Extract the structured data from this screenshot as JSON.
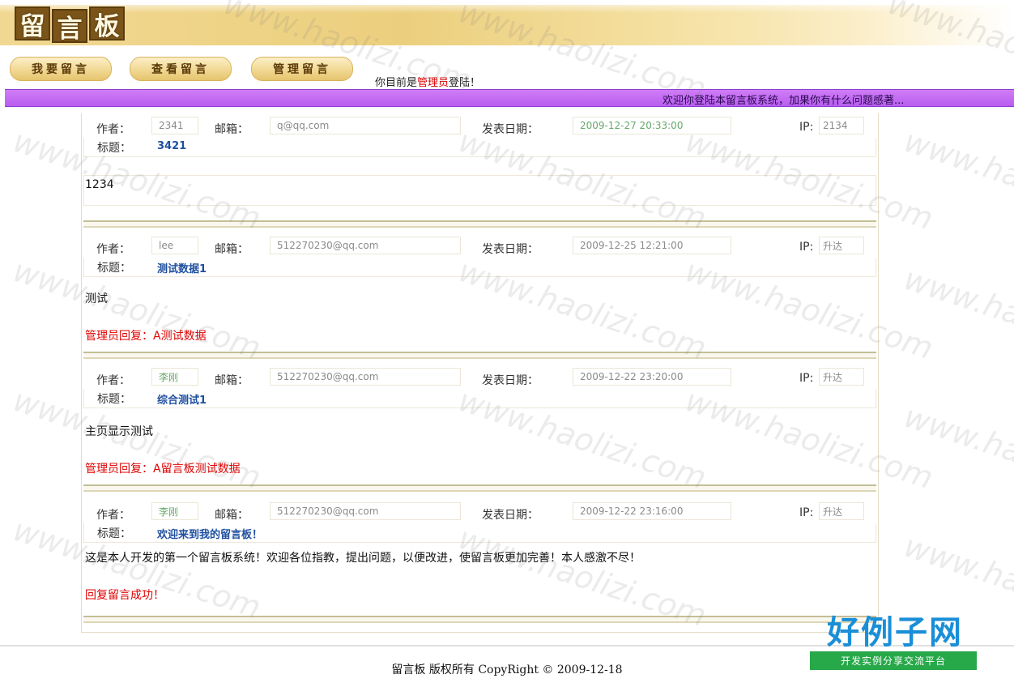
{
  "header": {
    "logo_chars": [
      "留",
      "言",
      "板"
    ]
  },
  "nav": [
    {
      "label": "我要留言"
    },
    {
      "label": "查看留言"
    },
    {
      "label": "管理留言"
    }
  ],
  "login": {
    "prefix": "你目前是",
    "role": "管理员",
    "suffix": "登陆！"
  },
  "marquee": {
    "text": "欢迎你登陆本留言板系统，加果你有什么问题感著..."
  },
  "labels": {
    "author": "作者：",
    "email": "邮箱：",
    "date": "发表日期：",
    "ip": "IP:",
    "title": "标题："
  },
  "messages": [
    {
      "author": "2341",
      "email": "q@qq.com",
      "date": "2009-12-27 20:33:00",
      "ip": "2134",
      "title": "3421",
      "content": "1234",
      "reply": ""
    },
    {
      "author": "lee",
      "email": "512270230@qq.com",
      "date": "2009-12-25 12:21:00",
      "ip": "升达",
      "title": "测试数据1",
      "content": "测试",
      "reply": "管理员回复：A测试数据"
    },
    {
      "author": "李刚",
      "email": "512270230@qq.com",
      "date": "2009-12-22 23:20:00",
      "ip": "升达",
      "title": "综合测试1",
      "content": "主页显示测试",
      "reply": "管理员回复：A留言板测试数据"
    },
    {
      "author": "李刚",
      "email": "512270230@qq.com",
      "date": "2009-12-22 23:16:00",
      "ip": "升达",
      "title": "欢迎来到我的留言板！",
      "content": "这是本人开发的第一个留言板系统！欢迎各位指教，提出问题，以便改进，使留言板更加完善！本人感激不尽！",
      "reply": "回复留言成功！"
    }
  ],
  "footer": {
    "copyright": "留言板  版权所有  CopyRight © 2009-12-18"
  },
  "watermark": {
    "text": "www.haolizi.com",
    "brand": "好例子网",
    "brand_sub": "开发实例分享交流平台"
  }
}
